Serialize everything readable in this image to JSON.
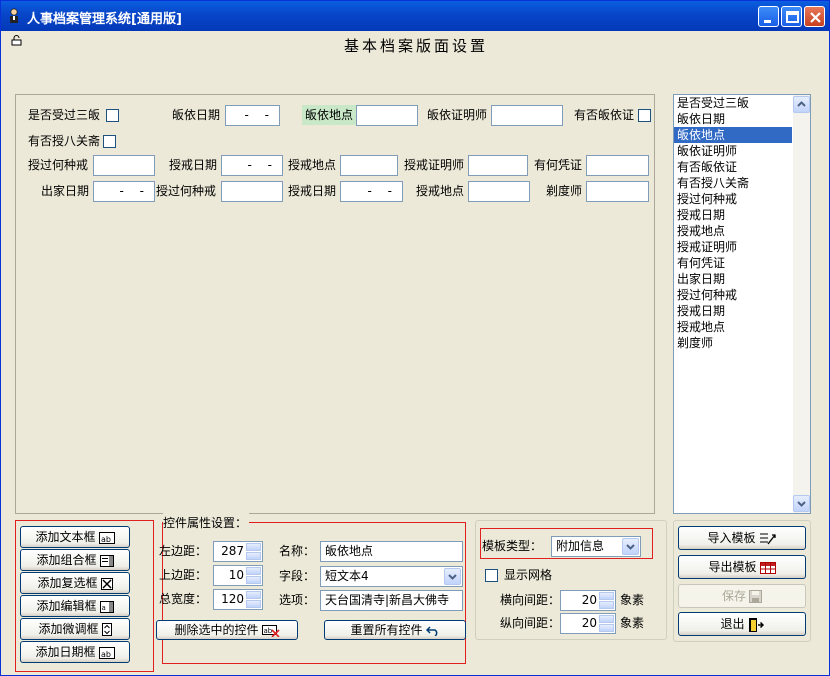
{
  "window": {
    "title": "人事档案管理系统[通用版]"
  },
  "heading": "基本档案版面设置",
  "canvas": {
    "row1": {
      "label_sanfei": "是否受过三皈",
      "label_guiyi_date": "皈依日期",
      "guiyi_date_value": "- -",
      "label_guiyi_place": "皈依地点",
      "label_guiyi_witness": "皈依证明师",
      "label_has_guiyi_cert": "有否皈依证"
    },
    "row2": {
      "label_baguan": "有否授八关斋"
    },
    "row3": {
      "label_shou_which": "授过何种戒",
      "label_shou_date": "授戒日期",
      "shou_date_value": "- -",
      "label_shou_place": "授戒地点",
      "label_shou_witness": "授戒证明师",
      "label_voucher": "有何凭证"
    },
    "row4": {
      "label_chujia_date": "出家日期",
      "chujia_date_value": "- -",
      "label_shou_which": "授过何种戒",
      "label_shou_date": "授戒日期",
      "shou_date_value": "- -",
      "label_shou_place": "授戒地点",
      "label_tidu": "剃度师"
    }
  },
  "field_list": {
    "items": [
      "是否受过三皈",
      "皈依日期",
      "皈依地点",
      "皈依证明师",
      "有否皈依证",
      "有否授八关斋",
      "授过何种戒",
      "授戒日期",
      "授戒地点",
      "授戒证明师",
      "有何凭证",
      "出家日期",
      "授过何种戒",
      "授戒日期",
      "授戒地点",
      "剃度师"
    ],
    "selected_index": 2
  },
  "add_buttons": {
    "textbox": "添加文本框",
    "combo": "添加组合框",
    "checkbox": "添加复选框",
    "editbox": "添加编辑框",
    "spin": "添加微调框",
    "datebox": "添加日期框"
  },
  "props": {
    "title": "控件属性设置：",
    "left_label": "左边距：",
    "left_value": "287",
    "top_label": "上边距：",
    "top_value": "10",
    "width_label": "总宽度：",
    "width_value": "120",
    "name_label": "名称：",
    "name_value": "皈依地点",
    "field_label": "字段：",
    "field_value": "短文本4",
    "option_label": "选项：",
    "option_value": "天台国清寺|新昌大佛寺",
    "delete_button": "删除选中的控件",
    "reset_button": "重置所有控件"
  },
  "template": {
    "type_label": "模板类型：",
    "type_value": "附加信息",
    "show_grid_label": "显示网格",
    "h_spacing_label": "横向间距：",
    "h_spacing_value": "20",
    "h_unit": "象素",
    "v_spacing_label": "纵向间距：",
    "v_spacing_value": "20",
    "v_unit": "象素"
  },
  "actions": {
    "import": "导入模板",
    "export": "导出模板",
    "save": "保存",
    "exit": "退出"
  }
}
